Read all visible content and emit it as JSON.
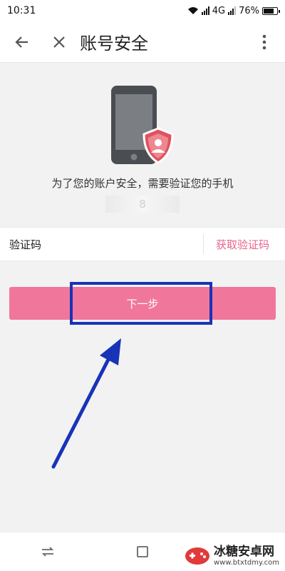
{
  "status_bar": {
    "time": "10:31",
    "network": "4G",
    "battery": "76%"
  },
  "header": {
    "title": "账号安全",
    "icons": [
      "arrow-back-icon",
      "close-icon",
      "more-vert-icon"
    ]
  },
  "hero": {
    "illustration": "phone-shield-icon",
    "message": "为了您的账户安全，需要验证您的手机",
    "masked_phone": "8"
  },
  "verification": {
    "label": "验证码",
    "input_value": "",
    "input_placeholder": "",
    "get_code_label": "获取验证码"
  },
  "actions": {
    "next_label": "下一步"
  },
  "nav_bar": {
    "icons": [
      "recent-apps-icon",
      "home-icon"
    ]
  },
  "watermark": {
    "name": "冰糖安卓网",
    "url": "www.btxtdmy.com"
  },
  "colors": {
    "accent_pink": "#f0779b",
    "link_pink": "#e8648c",
    "annotation_blue": "#1833b8",
    "shield_red": "#e0525e",
    "page_bg": "#f2f2f2"
  }
}
